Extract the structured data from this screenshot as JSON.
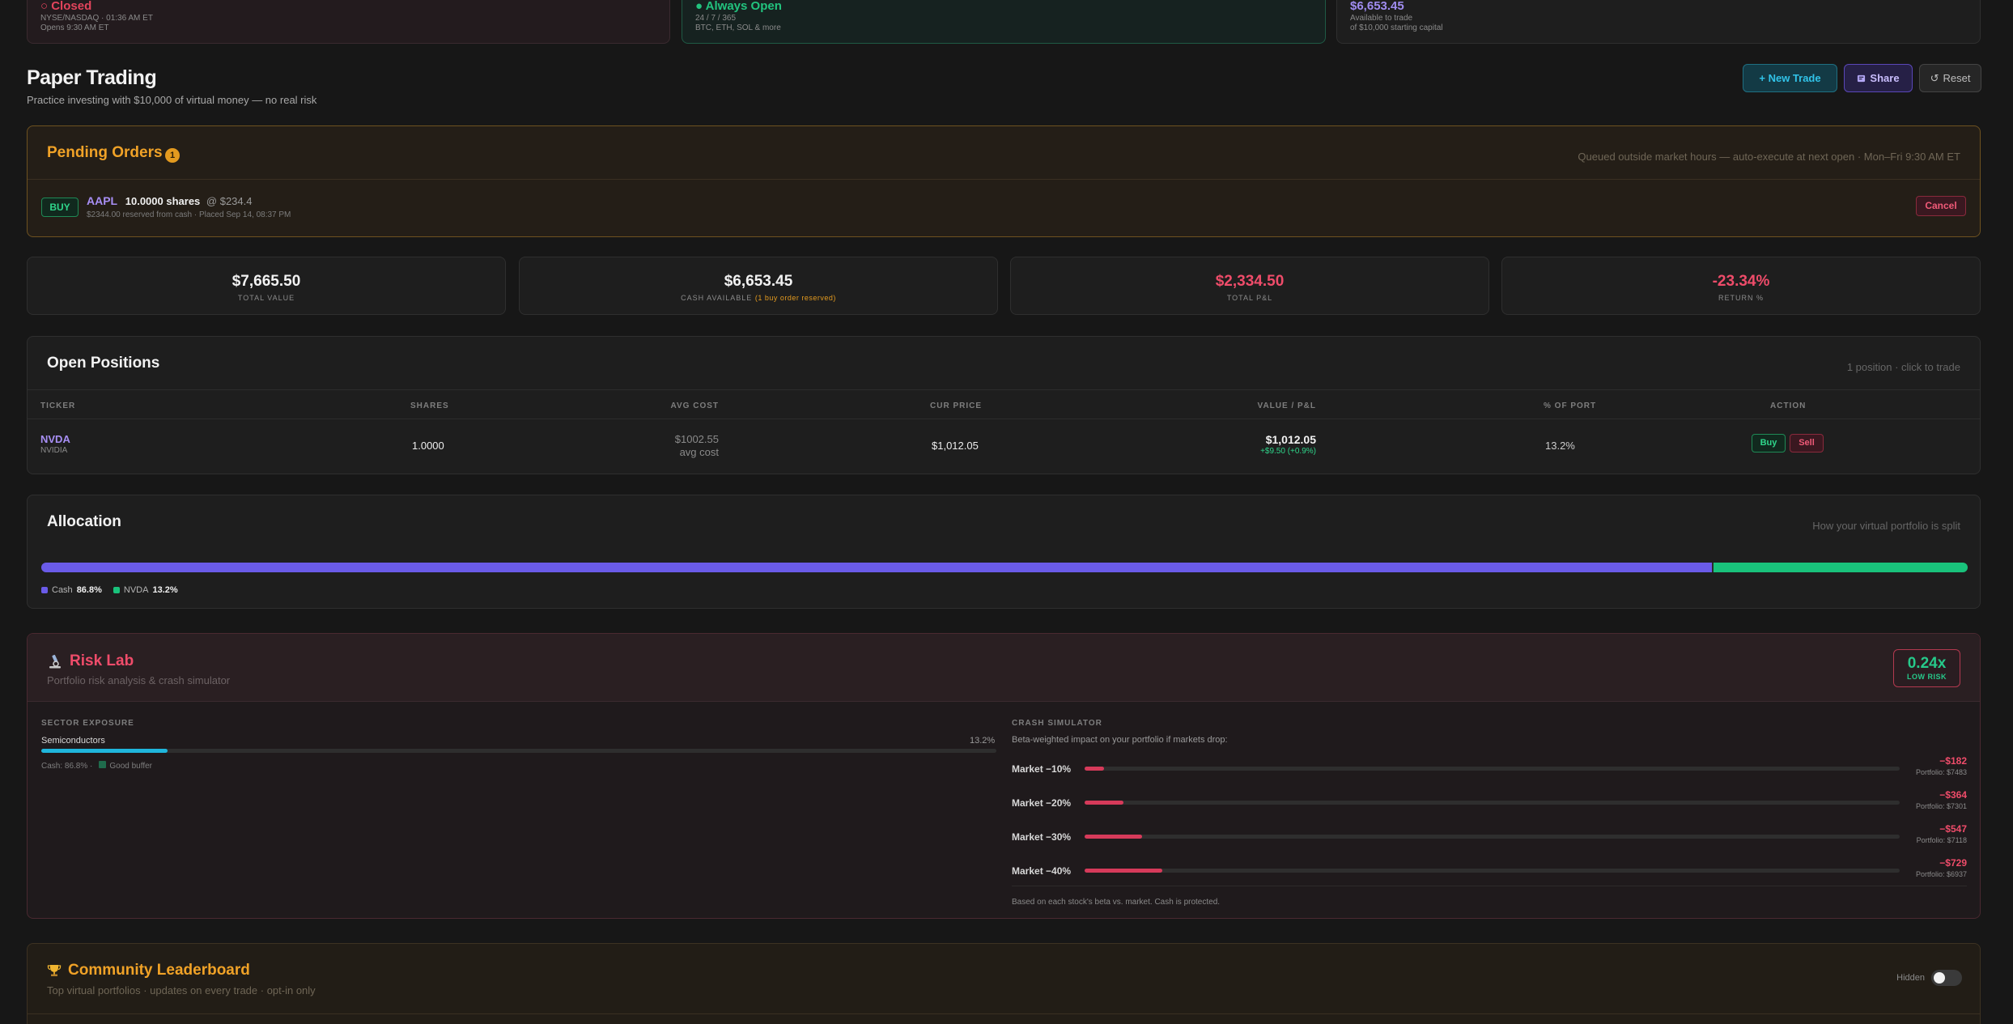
{
  "market_cards": {
    "stocks": {
      "status": "○ Closed",
      "line1": "NYSE/NASDAQ · 01:36 AM ET",
      "line2": "Opens 9:30 AM ET"
    },
    "crypto": {
      "status": "● Always Open",
      "line1": "24 / 7 / 365",
      "line2": "BTC, ETH, SOL & more"
    },
    "cash": {
      "amount": "$6,653.45",
      "line1": "Available to trade",
      "line2": "of $10,000 starting capital"
    }
  },
  "header": {
    "title": "Paper Trading",
    "subtitle": "Practice investing with $10,000 of virtual money — no real risk",
    "new_trade": "+ New Trade",
    "share": "Share",
    "reset": "Reset"
  },
  "pending": {
    "title": "Pending Orders",
    "count": "1",
    "note": "Queued outside market hours — auto-execute at next open · Mon–Fri 9:30 AM ET",
    "order": {
      "side": "BUY",
      "ticker": "AAPL",
      "shares": "10.0000 shares",
      "price": "@ $234.4",
      "detail": "$2344.00 reserved from cash · Placed Sep 14, 08:37 PM",
      "cancel": "Cancel"
    }
  },
  "stats": {
    "total_value": {
      "value": "$7,665.50",
      "label": "Total Value"
    },
    "cash": {
      "value": "$6,653.45",
      "label": "Cash Available",
      "note": "(1 buy order reserved)"
    },
    "pnl": {
      "value": "$2,334.50",
      "label": "Total P&L"
    },
    "return": {
      "value": "-23.34%",
      "label": "Return %"
    }
  },
  "positions": {
    "title": "Open Positions",
    "note": "1 position · click to trade",
    "columns": [
      "TICKER",
      "SHARES",
      "AVG COST",
      "CUR PRICE",
      "VALUE / P&L",
      "% OF PORT",
      "ACTION"
    ],
    "rows": [
      {
        "ticker": "NVDA",
        "name": "NVIDIA",
        "shares": "1.0000",
        "avg_cost": "$1002.55",
        "avg_cost_sub": "avg cost",
        "cur_price": "$1,012.05",
        "value": "$1,012.05",
        "pnl": "+$9.50 (+0.9%)",
        "pct_port": "13.2%",
        "buy": "Buy",
        "sell": "Sell"
      }
    ]
  },
  "allocation": {
    "title": "Allocation",
    "note": "How your virtual portfolio is split",
    "items": [
      {
        "label": "Cash",
        "value": "86.8%",
        "fraction": 0.868,
        "color": "#6a5be8"
      },
      {
        "label": "NVDA",
        "value": "13.2%",
        "fraction": 0.132,
        "color": "#19c27b"
      }
    ]
  },
  "risk_lab": {
    "icon": "microscope-icon",
    "title": "Risk Lab",
    "subtitle": "Portfolio risk analysis & crash simulator",
    "beta": "0.24x",
    "level": "LOW RISK",
    "sector_label": "SECTOR EXPOSURE",
    "sector": {
      "name": "Semiconductors",
      "pct": "13.2%",
      "fraction": 0.132
    },
    "cash_note": "Cash: 86.8% ·",
    "buffer_note": "Good buffer",
    "crash_label": "CRASH SIMULATOR",
    "crash_desc": "Beta-weighted impact on your portfolio if markets drop:",
    "scenarios": [
      {
        "name": "Market −10%",
        "loss": "−$182",
        "portfolio": "Portfolio: $7483",
        "fraction": 0.024
      },
      {
        "name": "Market −20%",
        "loss": "−$364",
        "portfolio": "Portfolio: $7301",
        "fraction": 0.048
      },
      {
        "name": "Market −30%",
        "loss": "−$547",
        "portfolio": "Portfolio: $7118",
        "fraction": 0.071
      },
      {
        "name": "Market −40%",
        "loss": "−$729",
        "portfolio": "Portfolio: $6937",
        "fraction": 0.095
      }
    ],
    "crash_note": "Based on each stock's beta vs. market. Cash is protected."
  },
  "leaderboard": {
    "icon": "trophy-icon",
    "title": "Community Leaderboard",
    "subtitle": "Top virtual portfolios · updates on every trade · opt-in only",
    "toggle_label": "Hidden",
    "toggle_on": false
  }
}
